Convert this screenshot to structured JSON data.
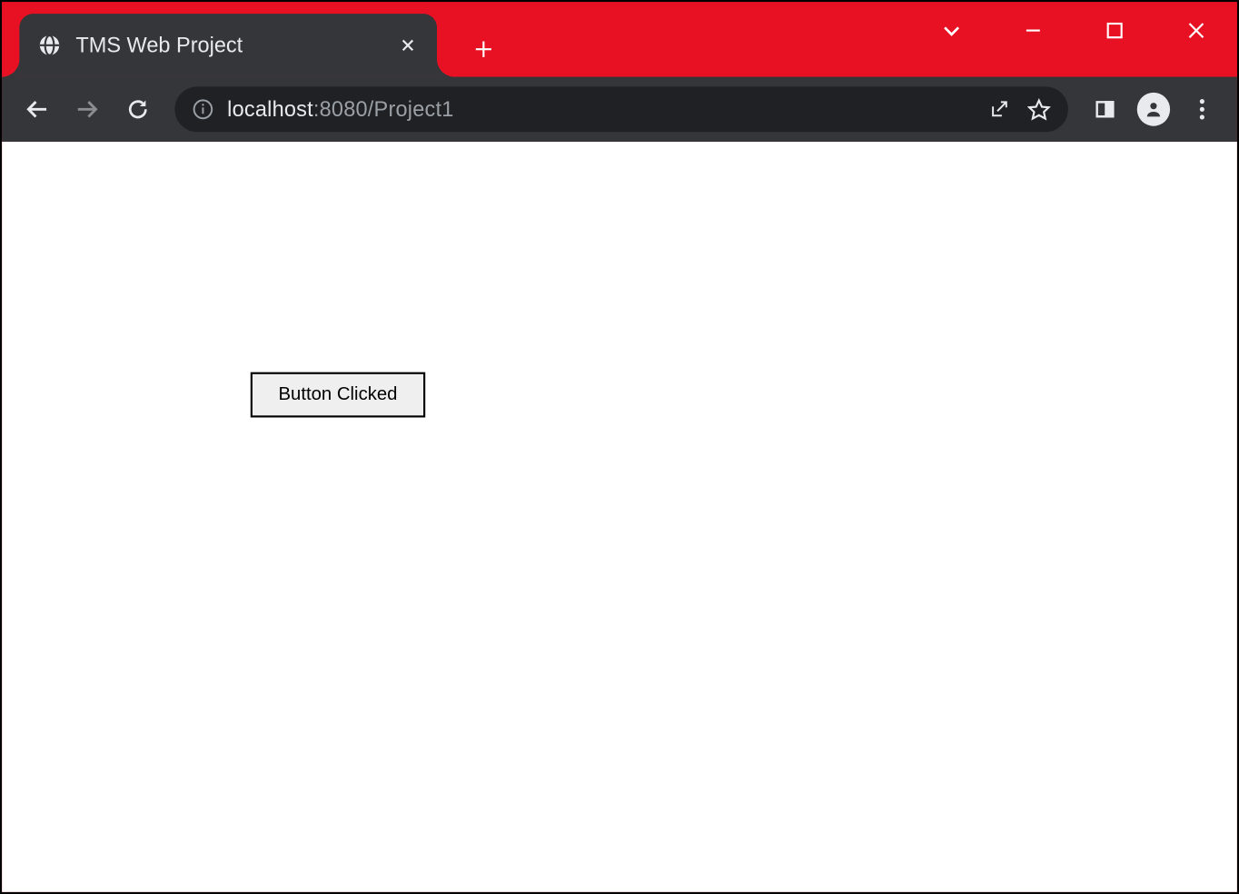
{
  "window": {
    "accent_color": "#e81123"
  },
  "tab": {
    "title": "TMS Web Project"
  },
  "address": {
    "host": "localhost",
    "port_path": ":8080/Project1"
  },
  "page": {
    "button_label": "Button Clicked"
  }
}
